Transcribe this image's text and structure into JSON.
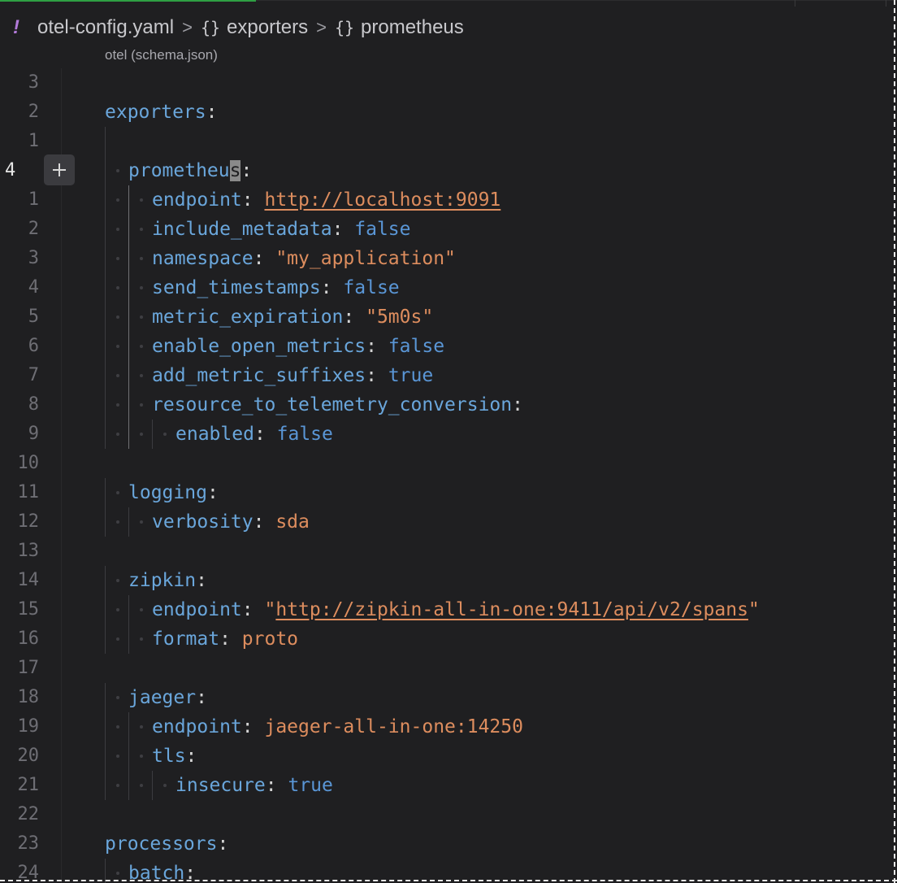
{
  "breadcrumb": {
    "file_icon": "!",
    "file_name": "otel-config.yaml",
    "separator": ">",
    "items": [
      {
        "icon": "{}",
        "label": "exporters"
      },
      {
        "icon": "{}",
        "label": "prometheus"
      }
    ]
  },
  "schema_label": "otel (schema.json)",
  "colors": {
    "key": "#6aa6db",
    "string": "#dd8d5e",
    "boolean": "#5a96d6",
    "punctuation": "#d4d4d4",
    "line_number": "#6e6e74",
    "background": "#1f1f21"
  },
  "editor": {
    "current_line_number": "4",
    "lines": [
      {
        "num": "3",
        "tokens": []
      },
      {
        "num": "2",
        "tokens": [
          {
            "t": "exporters",
            "c": "k"
          },
          {
            "t": ":",
            "c": "p"
          }
        ]
      },
      {
        "num": "1",
        "tokens": []
      },
      {
        "num": "4",
        "current": true,
        "tokens": [
          {
            "t": "prometheu",
            "c": "k"
          },
          {
            "t": "s",
            "c": "k cursor-char"
          },
          {
            "t": ":",
            "c": "p"
          }
        ]
      },
      {
        "num": "1",
        "tokens": [
          {
            "t": "endpoint",
            "c": "k"
          },
          {
            "t": ": ",
            "c": "p"
          },
          {
            "t": "http://localhost:9091",
            "c": "s u"
          }
        ]
      },
      {
        "num": "2",
        "tokens": [
          {
            "t": "include_metadata",
            "c": "k"
          },
          {
            "t": ": ",
            "c": "p"
          },
          {
            "t": "false",
            "c": "b"
          }
        ]
      },
      {
        "num": "3",
        "tokens": [
          {
            "t": "namespace",
            "c": "k"
          },
          {
            "t": ": ",
            "c": "p"
          },
          {
            "t": "\"my_application\"",
            "c": "s"
          }
        ]
      },
      {
        "num": "4",
        "tokens": [
          {
            "t": "send_timestamps",
            "c": "k"
          },
          {
            "t": ": ",
            "c": "p"
          },
          {
            "t": "false",
            "c": "b"
          }
        ]
      },
      {
        "num": "5",
        "tokens": [
          {
            "t": "metric_expiration",
            "c": "k"
          },
          {
            "t": ": ",
            "c": "p"
          },
          {
            "t": "\"5m0s\"",
            "c": "s"
          }
        ]
      },
      {
        "num": "6",
        "tokens": [
          {
            "t": "enable_open_metrics",
            "c": "k"
          },
          {
            "t": ": ",
            "c": "p"
          },
          {
            "t": "false",
            "c": "b"
          }
        ]
      },
      {
        "num": "7",
        "tokens": [
          {
            "t": "add_metric_suffixes",
            "c": "k"
          },
          {
            "t": ": ",
            "c": "p"
          },
          {
            "t": "true",
            "c": "b"
          }
        ]
      },
      {
        "num": "8",
        "tokens": [
          {
            "t": "resource_to_telemetry_conversion",
            "c": "k"
          },
          {
            "t": ":",
            "c": "p"
          }
        ]
      },
      {
        "num": "9",
        "tokens": [
          {
            "t": "enabled",
            "c": "k"
          },
          {
            "t": ": ",
            "c": "p"
          },
          {
            "t": "false",
            "c": "b"
          }
        ]
      },
      {
        "num": "10",
        "tokens": []
      },
      {
        "num": "11",
        "tokens": [
          {
            "t": "logging",
            "c": "k"
          },
          {
            "t": ":",
            "c": "p"
          }
        ]
      },
      {
        "num": "12",
        "tokens": [
          {
            "t": "verbosity",
            "c": "k"
          },
          {
            "t": ": ",
            "c": "p"
          },
          {
            "t": "sda",
            "c": "s"
          }
        ]
      },
      {
        "num": "13",
        "tokens": []
      },
      {
        "num": "14",
        "tokens": [
          {
            "t": "zipkin",
            "c": "k"
          },
          {
            "t": ":",
            "c": "p"
          }
        ]
      },
      {
        "num": "15",
        "tokens": [
          {
            "t": "endpoint",
            "c": "k"
          },
          {
            "t": ": ",
            "c": "p"
          },
          {
            "t": "\"",
            "c": "s"
          },
          {
            "t": "http://zipkin-all-in-one:9411/api/v2/spans",
            "c": "s u"
          },
          {
            "t": "\"",
            "c": "s"
          }
        ]
      },
      {
        "num": "16",
        "tokens": [
          {
            "t": "format",
            "c": "k"
          },
          {
            "t": ": ",
            "c": "p"
          },
          {
            "t": "proto",
            "c": "s"
          }
        ]
      },
      {
        "num": "17",
        "tokens": []
      },
      {
        "num": "18",
        "tokens": [
          {
            "t": "jaeger",
            "c": "k"
          },
          {
            "t": ":",
            "c": "p"
          }
        ]
      },
      {
        "num": "19",
        "tokens": [
          {
            "t": "endpoint",
            "c": "k"
          },
          {
            "t": ": ",
            "c": "p"
          },
          {
            "t": "jaeger-all-in-one:14250",
            "c": "s"
          }
        ]
      },
      {
        "num": "20",
        "tokens": [
          {
            "t": "tls",
            "c": "k"
          },
          {
            "t": ":",
            "c": "p"
          }
        ]
      },
      {
        "num": "21",
        "tokens": [
          {
            "t": "insecure",
            "c": "k"
          },
          {
            "t": ": ",
            "c": "p"
          },
          {
            "t": "true",
            "c": "b"
          }
        ]
      },
      {
        "num": "22",
        "tokens": []
      },
      {
        "num": "23",
        "tokens": [
          {
            "t": "processors",
            "c": "k"
          },
          {
            "t": ":",
            "c": "p"
          }
        ]
      },
      {
        "num": "24",
        "tokens": [
          {
            "t": "batch",
            "c": "k"
          },
          {
            "t": ":",
            "c": "p"
          }
        ]
      }
    ]
  }
}
